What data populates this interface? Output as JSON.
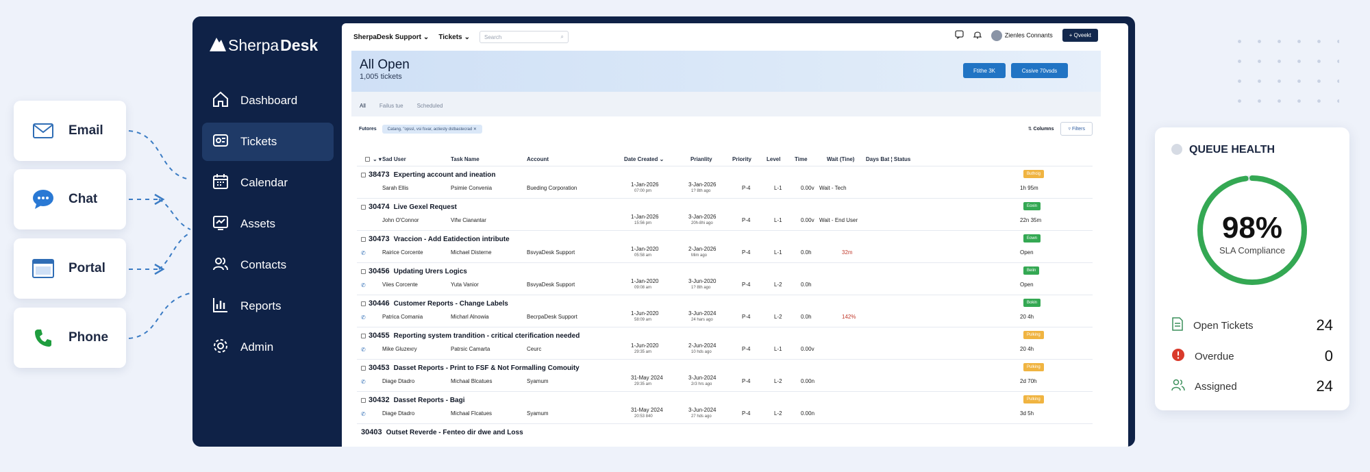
{
  "channels": [
    {
      "label": "Email",
      "icon": "envelope-icon"
    },
    {
      "label": "Chat",
      "icon": "chat-bubble-icon"
    },
    {
      "label": "Portal",
      "icon": "browser-window-icon"
    },
    {
      "label": "Phone",
      "icon": "phone-icon"
    }
  ],
  "brand": {
    "prefix": "Sherpa",
    "suffix": "Desk"
  },
  "nav": [
    {
      "label": "Dashboard",
      "icon": "home-icon"
    },
    {
      "label": "Tickets",
      "icon": "tickets-icon",
      "active": true
    },
    {
      "label": "Calendar",
      "icon": "calendar-icon"
    },
    {
      "label": "Assets",
      "icon": "assets-icon"
    },
    {
      "label": "Contacts",
      "icon": "contacts-icon"
    },
    {
      "label": "Reports",
      "icon": "reports-icon"
    },
    {
      "label": "Admin",
      "icon": "gear-icon"
    }
  ],
  "topbar": {
    "org": "SherpaDesk Support",
    "tickets": "Tickets",
    "search_placeholder": "Search",
    "user": "Zienles Connants",
    "new_button": "+ Qveekt"
  },
  "header": {
    "title": "All Open",
    "count": "1,005 tickets",
    "btn1": "Ftithe 3K",
    "btn2": "Cssive 70vsds"
  },
  "tabs": [
    "All",
    "Failus tue",
    "Scheduled"
  ],
  "filter": {
    "label": "Futores",
    "chip": "Catang, \"opssl, vsi fsvar, actiesty dstbastecrad",
    "columns": "Columns",
    "filters": "Filters"
  },
  "columns": [
    "Sad User",
    "Task Name",
    "Account",
    "Date Created",
    "Prianlity",
    "Priority",
    "Level",
    "Time",
    "Wait (Tine)",
    "Days Bat ¦ Status"
  ],
  "tickets": [
    {
      "id": "38473",
      "title": "Experting account and ineation",
      "user": "Sarah Ellis",
      "task": "Psimie Convenia",
      "account": "Bueding Corporation",
      "created": "1-Jan-2026",
      "created_sub": "07:00 pm",
      "pri_date": "3-Jan-2026",
      "pri_sub": "1? 8th ago",
      "priority": "P-4",
      "level": "L-1",
      "time": "0.00v",
      "wait": "Wait - Tech",
      "wait_alert": false,
      "badge": "Buthcig",
      "badge_color": "#f0b441",
      "status": "1h 95m"
    },
    {
      "id": "30474",
      "title": "Live Gexel Request",
      "user": "John O'Connor",
      "task": "Vifw Cianantar",
      "account": "",
      "created": "1-Jan-2026",
      "created_sub": "15:56 pm",
      "pri_date": "3-Jan-2026",
      "pri_sub": "20h-8hi ago",
      "priority": "P-4",
      "level": "L-1",
      "time": "0.00v",
      "wait": "Wait - End User",
      "wait_alert": false,
      "badge": "Eoxin",
      "badge_color": "#34a853",
      "status": "22n 35m"
    },
    {
      "id": "30473",
      "title": "Vraccion - Add Eatidection intribute",
      "user": "Rairice Corcente",
      "task": "Michael Disterne",
      "account": "BsvyaDesk Support",
      "created": "1-Jan-2020",
      "created_sub": "05:58 am",
      "pri_date": "2-Jan-2026",
      "pri_sub": "Mim ago",
      "priority": "P-4",
      "level": "L-1",
      "time": "0.0h",
      "wait": "32m",
      "wait_alert": true,
      "badge": "Eown",
      "badge_color": "#34a853",
      "status": "Open"
    },
    {
      "id": "30456",
      "title": "Updating Urers Logics",
      "user": "Viies Corcente",
      "task": "Yuta Vanior",
      "account": "BsvyaDesk Support",
      "created": "1-Jan-2020",
      "created_sub": "09:08 am",
      "pri_date": "3-Jun-2020",
      "pri_sub": "1? 8th ago",
      "priority": "P-4",
      "level": "L-2",
      "time": "0.0h",
      "wait": "",
      "wait_alert": false,
      "badge": "Beiin",
      "badge_color": "#34a853",
      "status": "Open"
    },
    {
      "id": "30446",
      "title": "Customer Reports - Change Labels",
      "user": "Patrica Comania",
      "task": "Micharl Alnowia",
      "account": "BecrpaDesk Support",
      "created": "1-Jun-2020",
      "created_sub": "58:09 am",
      "pri_date": "3-Jun-2024",
      "pri_sub": "24 hars ago",
      "priority": "P-4",
      "level": "L-2",
      "time": "0.0h",
      "wait": "142%",
      "wait_alert": true,
      "badge": "Bokin",
      "badge_color": "#34a853",
      "status": "20 4h"
    },
    {
      "id": "30455",
      "title": "Reporting system trandition - critical cterification needed",
      "user": "Mike Gluzexry",
      "task": "Patrsic Camarta",
      "account": "Ceurc",
      "created": "1-Jun-2020",
      "created_sub": "29:35 am",
      "pri_date": "2-Jun-2024",
      "pri_sub": "10 hds ago",
      "priority": "P-4",
      "level": "L-1",
      "time": "0.00v",
      "wait": "",
      "wait_alert": false,
      "badge": "Pulking",
      "badge_color": "#f0b441",
      "status": "20 4h"
    },
    {
      "id": "30453",
      "title": "Dasset Reports - Print to FSF & Not Formalling Comouity",
      "user": "Diage Dtadro",
      "task": "Michaal Blcatues",
      "account": "Syamum",
      "created": "31-May 2024",
      "created_sub": "29:35 am",
      "pri_date": "3-Jun-2024",
      "pri_sub": "2r3 hrs ago",
      "priority": "P-4",
      "level": "L-2",
      "time": "0.00n",
      "wait": "",
      "wait_alert": false,
      "badge": "Pulking",
      "badge_color": "#f0b441",
      "status": "2d 70h"
    },
    {
      "id": "30432",
      "title": "Dasset Reports - Bagi",
      "user": "Diage Dtadro",
      "task": "Michaal Flcatues",
      "account": "Syamum",
      "created": "31-May 2024",
      "created_sub": "20:53 840",
      "pri_date": "3-Jun-2024",
      "pri_sub": "27 hds ago",
      "priority": "P-4",
      "level": "L-2",
      "time": "0.00n",
      "wait": "",
      "wait_alert": false,
      "badge": "Pulking",
      "badge_color": "#f0b441",
      "status": "3d 5h"
    }
  ],
  "partial_row": {
    "id": "30403",
    "title": "Outset Reverde - Fenteo dir dwe and Loss"
  },
  "queue_health": {
    "title": "QUEUE HEALTH",
    "sla_percent": 98,
    "sla_display": "98%",
    "sla_label": "SLA Compliance",
    "ring_color": "#34a853",
    "metrics": [
      {
        "label": "Open Tickets",
        "value": "24",
        "icon": "document-icon"
      },
      {
        "label": "Overdue",
        "value": "0",
        "icon": "alert-icon"
      },
      {
        "label": "Assigned",
        "value": "24",
        "icon": "users-icon"
      }
    ]
  },
  "colors": {
    "sidebar": "#0f2247",
    "accent": "#2174c4",
    "overdue": "#d93a2b"
  }
}
